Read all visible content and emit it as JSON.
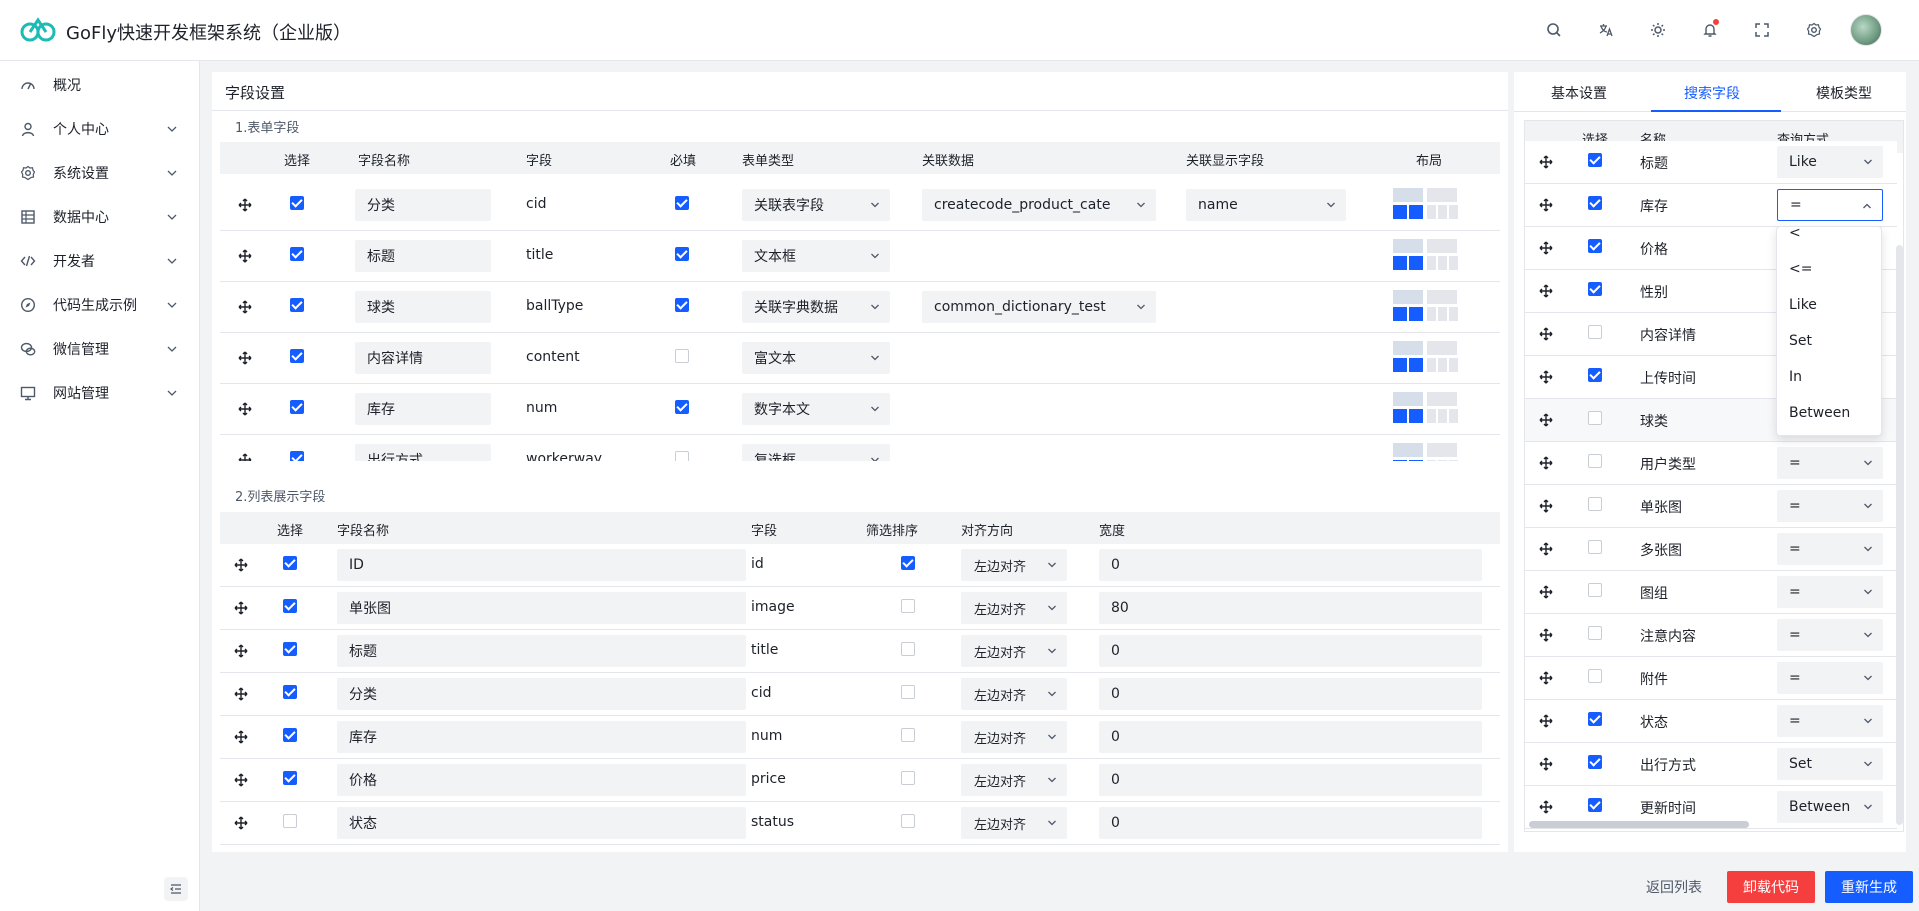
{
  "header": {
    "title": "GoFly快速开发框架系统（企业版）",
    "icons": [
      "search-icon",
      "translate-icon",
      "theme-icon",
      "bell-icon",
      "fullscreen-icon",
      "settings-icon"
    ]
  },
  "sidebar": {
    "items": [
      {
        "label": "概况",
        "icon": "dashboard-icon"
      },
      {
        "label": "个人中心",
        "icon": "user-icon"
      },
      {
        "label": "系统设置",
        "icon": "gear-icon"
      },
      {
        "label": "数据中心",
        "icon": "database-icon"
      },
      {
        "label": "开发者",
        "icon": "code-icon"
      },
      {
        "label": "代码生成示例",
        "icon": "compass-icon"
      },
      {
        "label": "微信管理",
        "icon": "wechat-icon"
      },
      {
        "label": "网站管理",
        "icon": "monitor-icon"
      }
    ]
  },
  "left_panel": {
    "title": "字段设置",
    "section1": "1.表单字段",
    "section2": "2.列表展示字段",
    "form_headers": [
      "选择",
      "字段名称",
      "字段",
      "必填",
      "表单类型",
      "关联数据",
      "关联显示字段",
      "布局"
    ],
    "form_rows": [
      {
        "selected": true,
        "name": "分类",
        "field": "cid",
        "required": true,
        "type": "关联表字段",
        "relation": "createcode_product_cate",
        "display": "name"
      },
      {
        "selected": true,
        "name": "标题",
        "field": "title",
        "required": true,
        "type": "文本框",
        "relation": "",
        "display": ""
      },
      {
        "selected": true,
        "name": "球类",
        "field": "ballType",
        "required": true,
        "type": "关联字典数据",
        "relation": "common_dictionary_test",
        "display": ""
      },
      {
        "selected": true,
        "name": "内容详情",
        "field": "content",
        "required": false,
        "type": "富文本",
        "relation": "",
        "display": ""
      },
      {
        "selected": true,
        "name": "库存",
        "field": "num",
        "required": true,
        "type": "数字本文",
        "relation": "",
        "display": ""
      },
      {
        "selected": true,
        "name": "出行方式",
        "field": "workerway",
        "required": false,
        "type": "复选框",
        "relation": "",
        "display": ""
      }
    ],
    "list_headers": [
      "选择",
      "字段名称",
      "字段",
      "筛选排序",
      "对齐方向",
      "宽度"
    ],
    "list_rows": [
      {
        "selected": true,
        "name": "ID",
        "field": "id",
        "sort": true,
        "align": "左边对齐",
        "width": "0"
      },
      {
        "selected": true,
        "name": "单张图",
        "field": "image",
        "sort": false,
        "align": "左边对齐",
        "width": "80"
      },
      {
        "selected": true,
        "name": "标题",
        "field": "title",
        "sort": false,
        "align": "左边对齐",
        "width": "0"
      },
      {
        "selected": true,
        "name": "分类",
        "field": "cid",
        "sort": false,
        "align": "左边对齐",
        "width": "0"
      },
      {
        "selected": true,
        "name": "库存",
        "field": "num",
        "sort": false,
        "align": "左边对齐",
        "width": "0"
      },
      {
        "selected": true,
        "name": "价格",
        "field": "price",
        "sort": false,
        "align": "左边对齐",
        "width": "0"
      },
      {
        "selected": false,
        "name": "状态",
        "field": "status",
        "sort": false,
        "align": "左边对齐",
        "width": "0"
      }
    ]
  },
  "right_panel": {
    "tabs": [
      "基本设置",
      "搜索字段",
      "模板类型"
    ],
    "active_tab": "搜索字段",
    "headers": [
      "选择",
      "名称",
      "查询方式"
    ],
    "rows": [
      {
        "selected": true,
        "name": "标题",
        "query": "Like"
      },
      {
        "selected": true,
        "name": "库存",
        "query": "="
      },
      {
        "selected": true,
        "name": "价格",
        "query": ""
      },
      {
        "selected": true,
        "name": "性别",
        "query": ""
      },
      {
        "selected": false,
        "name": "内容详情",
        "query": ""
      },
      {
        "selected": true,
        "name": "上传时间",
        "query": ""
      },
      {
        "selected": false,
        "name": "球类",
        "query": ""
      },
      {
        "selected": false,
        "name": "用户类型",
        "query": "="
      },
      {
        "selected": false,
        "name": "单张图",
        "query": "="
      },
      {
        "selected": false,
        "name": "多张图",
        "query": "="
      },
      {
        "selected": false,
        "name": "图组",
        "query": "="
      },
      {
        "selected": false,
        "name": "注意内容",
        "query": "="
      },
      {
        "selected": false,
        "name": "附件",
        "query": "="
      },
      {
        "selected": true,
        "name": "状态",
        "query": "="
      },
      {
        "selected": true,
        "name": "出行方式",
        "query": "Set"
      },
      {
        "selected": true,
        "name": "更新时间",
        "query": "Between"
      }
    ],
    "dropdown_options": [
      "<",
      "<=",
      "Like",
      "Set",
      "In",
      "Between"
    ]
  },
  "footer": {
    "back": "返回列表",
    "uninstall": "卸载代码",
    "regenerate": "重新生成"
  },
  "colors": {
    "primary": "#165dff",
    "danger": "#f53f3f",
    "logo": "#1cbbb4"
  }
}
